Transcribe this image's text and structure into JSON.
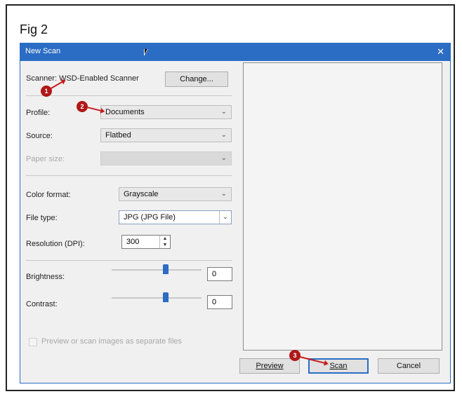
{
  "figure": {
    "label": "Fig 2"
  },
  "window": {
    "title": "New Scan",
    "close": "✕"
  },
  "scanner": {
    "label": "Scanner: WSD-Enabled Scanner",
    "change_button": "Change..."
  },
  "form": {
    "profile": {
      "label": "Profile:",
      "value": "Documents"
    },
    "source": {
      "label": "Source:",
      "value": "Flatbed"
    },
    "paper_size": {
      "label": "Paper size:",
      "value": ""
    },
    "color_format": {
      "label": "Color format:",
      "value": "Grayscale"
    },
    "file_type": {
      "label": "File type:",
      "value": "JPG (JPG File)"
    },
    "resolution": {
      "label": "Resolution (DPI):",
      "value": "300"
    },
    "brightness": {
      "label": "Brightness:",
      "value": "0"
    },
    "contrast": {
      "label": "Contrast:",
      "value": "0"
    },
    "separate_files": {
      "label": "Preview or scan images as separate files",
      "checked": false
    }
  },
  "buttons": {
    "preview": "Preview",
    "scan": "Scan",
    "cancel": "Cancel"
  },
  "annotations": {
    "badge1": "1",
    "badge2": "2",
    "badge3": "3"
  },
  "colors": {
    "title_bar": "#2b6cc4",
    "annotation": "#b01818"
  }
}
